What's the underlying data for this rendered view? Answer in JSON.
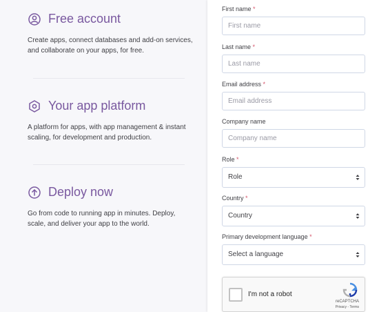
{
  "features": [
    {
      "icon": "user-circle-icon",
      "title": "Free account",
      "desc": "Create apps, connect databases and add-on services, and collaborate on your apps, for free."
    },
    {
      "icon": "hexagon-icon",
      "title": "Your app platform",
      "desc": "A platform for apps, with app management & instant scaling, for development and production."
    },
    {
      "icon": "upload-arrow-icon",
      "title": "Deploy now",
      "desc": "Go from code to running app in minutes. Deploy, scale, and deliver your app to the world."
    }
  ],
  "form": {
    "required_mark": "*",
    "first_name": {
      "label": "First name",
      "placeholder": "First name"
    },
    "last_name": {
      "label": "Last name",
      "placeholder": "Last name"
    },
    "email": {
      "label": "Email address",
      "placeholder": "Email address"
    },
    "company": {
      "label": "Company name",
      "placeholder": "Company name"
    },
    "role": {
      "label": "Role",
      "value": "Role"
    },
    "country": {
      "label": "Country",
      "value": "Country"
    },
    "language": {
      "label": "Primary development language",
      "value": "Select a language"
    }
  },
  "captcha": {
    "text": "I'm not a robot",
    "brand": "reCAPTCHA",
    "links": "Privacy - Terms"
  },
  "colors": {
    "accent": "#79589f",
    "required": "#d6546a"
  }
}
